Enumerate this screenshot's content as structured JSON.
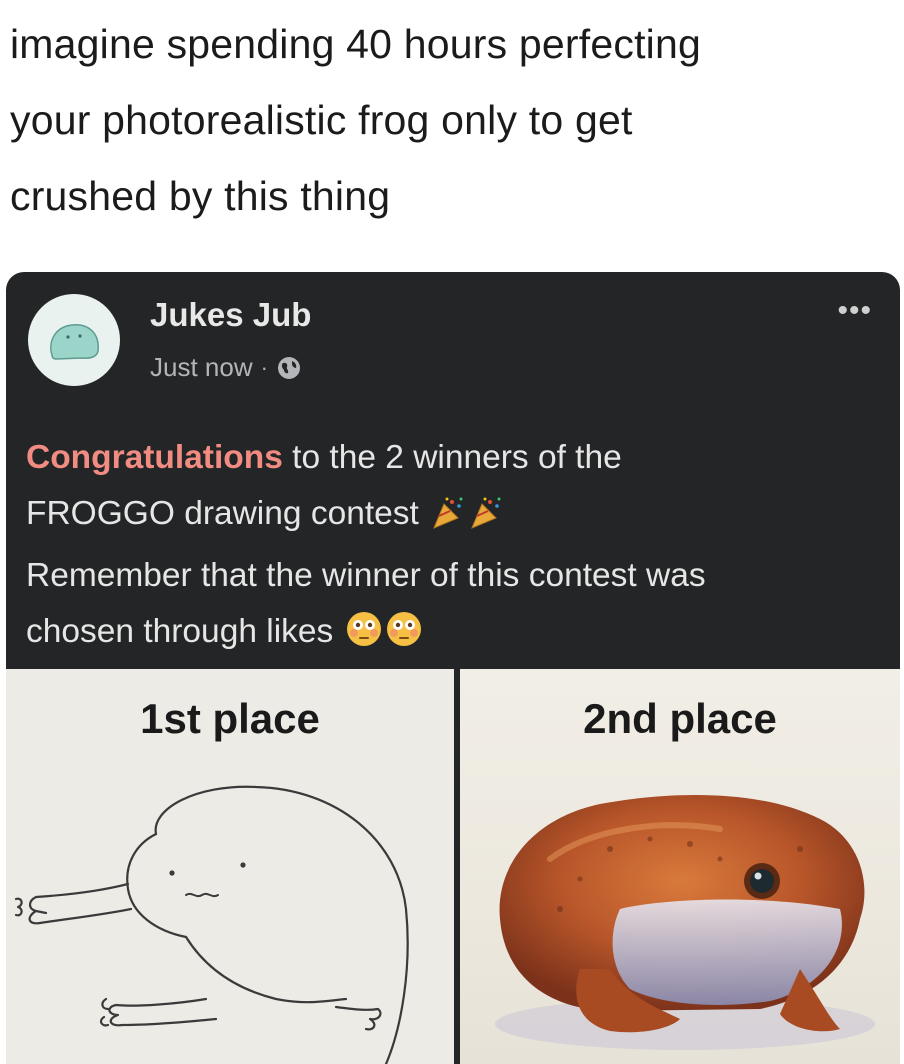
{
  "caption": {
    "line1": "imagine spending 40 hours perfecting",
    "line2": "your photorealistic frog only to get",
    "line3": "crushed by this thing"
  },
  "post": {
    "author": "Jukes Jub",
    "timestamp": "Just now",
    "separator": "·",
    "privacy_icon": "globe-icon",
    "more_label": "•••",
    "text": {
      "highlight": "Congratulations",
      "line1_rest": " to the 2 winners of the",
      "line2": "FROGGO drawing contest",
      "line3": "Remember that the winner of this contest was",
      "line4": "chosen through likes"
    },
    "emojis": [
      "party-popper-icon",
      "party-popper-icon",
      "flushed-face-icon",
      "flushed-face-icon"
    ]
  },
  "panels": {
    "first": {
      "label": "1st place"
    },
    "second": {
      "label": "2nd place"
    }
  },
  "colors": {
    "post_background": "#242526",
    "highlight": "#f28c82",
    "caption_text": "#1b1b1b"
  }
}
